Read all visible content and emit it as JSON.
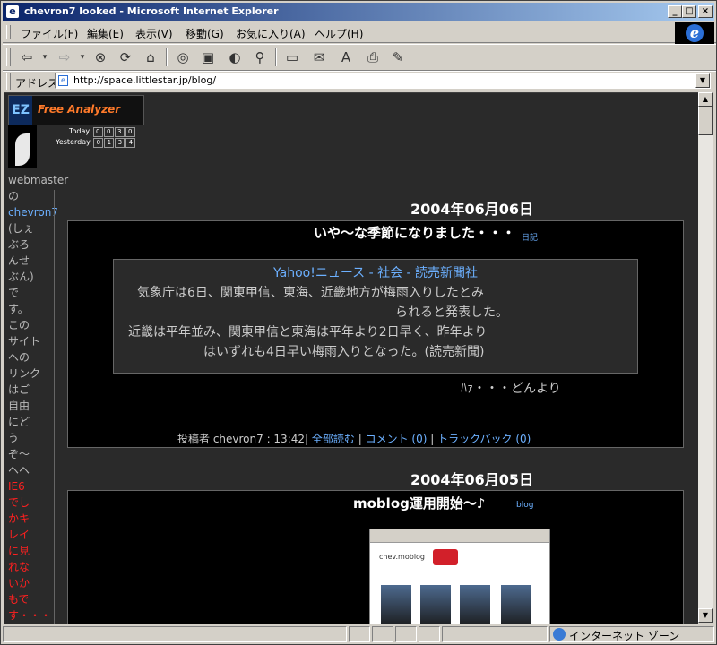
{
  "window": {
    "title": "chevron7 looked - Microsoft Internet Explorer"
  },
  "menu": [
    "ファイル(F)",
    "編集(E)",
    "表示(V)",
    "移動(G)",
    "お気に入り(A)",
    "ヘルプ(H)"
  ],
  "toolbar": {
    "icons": [
      "back-icon",
      "forward-icon",
      "stop-icon",
      "refresh-icon",
      "home-icon",
      "search-icon",
      "favorites-icon",
      "history-icon",
      "channels-icon",
      "fullscreen-icon",
      "mail-icon",
      "font-icon",
      "print-icon",
      "edit-icon"
    ]
  },
  "address": {
    "label": "アドレス",
    "url": "http://space.littlestar.jp/blog/"
  },
  "status": {
    "zone": "インターネット ゾーン"
  },
  "counter": {
    "brand_left": "EZ",
    "brand_right": "Free Analyzer",
    "today_label": "Today",
    "today_digits": [
      "0",
      "0",
      "3",
      "0"
    ],
    "yesterday_label": "Yesterday",
    "yesterday_digits": [
      "0",
      "1",
      "3",
      "4"
    ]
  },
  "sidebar": {
    "lines": [
      "webmaster",
      "の",
      "chevron7",
      "(しぇ",
      "ぶろ",
      "んせ",
      "ぶん)",
      "で",
      "す。",
      "この",
      "サイト",
      "への",
      "リンク",
      "はご",
      "自由",
      "にど",
      "う",
      "ぞ～",
      "ヘヘ",
      "IE6",
      "でし",
      "かキ",
      "レイ",
      "に見",
      "れな",
      "いか",
      "もで",
      "す・・・"
    ]
  },
  "posts": [
    {
      "date": "2004年06月06日",
      "title": "いや～な季節になりました・・・",
      "category": "日記",
      "quote": {
        "source": "Yahoo!ニュース - 社会 - 読売新聞社",
        "line1": "気象庁は6日、関東甲信、東海、近畿地方が梅雨入りしたとみ",
        "line2": "られると発表した。",
        "line3": "近畿は平年並み、関東甲信と東海は平年より2日早く、昨年より",
        "line4": "はいずれも4日早い梅雨入りとなった。(読売新聞)"
      },
      "comment": "ﾊｧ・・・どんより",
      "footer": {
        "author_label": "投稿者 chevron7 : 13:42|",
        "read_all": "全部読む",
        "comments": "コメント (0)",
        "trackback": "トラックバック (0)",
        "sep": "|"
      }
    },
    {
      "date": "2004年06月05日",
      "title": "moblog運用開始～♪",
      "category": "blog",
      "image_caption": "chev.moblog"
    }
  ]
}
